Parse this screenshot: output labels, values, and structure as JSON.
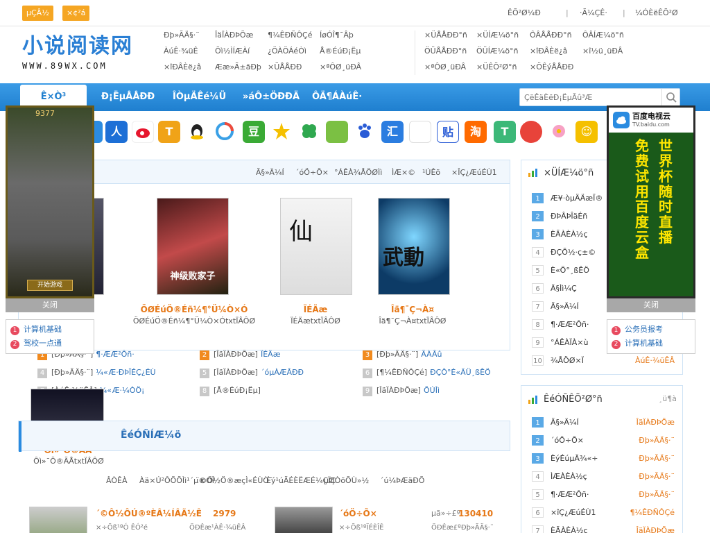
{
  "topbar": {
    "btn1": "µÇÂ½",
    "btn2": "×¢²á",
    "link1": "ÊÕ²Ø¼Ð",
    "link2": "·Ã¼ÇÊ·",
    "link3": "¼ÓÈëÊÕ²Ø",
    "sep": "|"
  },
  "logo": {
    "cn": "小说阅读网",
    "url": "WWW.89WX.COM"
  },
  "header_cats": [
    [
      "Ðþ»ÃÄ§·¨",
      "ÎäÏÀÐÞÕæ",
      "¶¼ÊÐÑÔÇé"
    ],
    [
      "ÀúÊ·¾üÊ",
      "Õì½ÌÍÆÀí",
      "ÍøÓÎ¶¯Âþ"
    ],
    [
      "¿Æ»ÃÐ¡Ëµ",
      "¿ÖÀÖÁéÒì",
      "Å®ÉúÐ¡Ëµ"
    ],
    [
      "ÆäËûÀàÐÍ",
      "Ææ»Ã±äÐþ",
      "×ÜÅÅÐÐ"
    ],
    [
      "×ÜÅÅÐÐ°ñ",
      "×ÜÍÆ¼ö°ñ",
      "ÔÂÅÅÐÐ°ñ"
    ],
    [
      "ÔÂÍÆ¼ö°ñ",
      "ÖÜÅÅÐÐ°ñ",
      "ÖÜÍÆ¼ö°ñ"
    ],
    [
      "×îÐÂÈë¿â",
      "×î½ü¸üÐÂ",
      "×ªÔØ¸üÐÂ"
    ]
  ],
  "header_right": [
    [
      "×ÜÅÅÐÐ°ñ",
      "×ÜÍÆ¼ö°ñ",
      "ÔÂÅÅÐÐ°ñ",
      "ÔÂÍÆ¼ö°ñ"
    ],
    [
      "ÖÜÅÅÐÐ°ñ",
      "ÖÜÍÆ¼ö°ñ",
      "×îÐÂÈë¿â",
      "×î½ü¸üÐÂ"
    ],
    [
      "×ªÔØ¸üÐÂ",
      "×ÜÊÕ²Ø°ñ",
      "×ÖÊýÅÅÐÐ"
    ]
  ],
  "nav": {
    "items": [
      "Ê×Ò³",
      "Ð¡ËµÅÅÐÐ",
      "ÎÒµÄÊé¼Ü",
      "»áÔ±ÖÐÐÄ",
      "ÔÄ¶ÁÀúÊ·"
    ],
    "search_placeholder": "ÇëÊäÈëÐ¡ËµÃû³Æ"
  },
  "apps": [
    "人",
    "豆",
    "贴",
    "淘"
  ],
  "hot": {
    "tabs": [
      "Ã§»Ä¼Í",
      "´óÖ÷Õ×",
      "°ÁÊÀ¾ÅÖØÌì",
      "ÌÆ×©",
      "¹ÚÊõ",
      "×ÎÇ¿ÆúÉÙ1"
    ],
    "books": [
      {
        "title": "ÖØÉúÖ®Éñ¼¶°Ü¼Ò×Ó",
        "sub": "ÖØÉúÖ®Éñ¼¶°Ü¼Ò×ÓtxtÏÂÔØ"
      },
      {
        "title": "ÏÉÄæ",
        "sub": "ÏÉÄætxtÏÂÔØ"
      },
      {
        "title": "Îä¶¯Ç¬À¤",
        "sub": "Îä¶¯Ç¬À¤txtÏÂÔØ"
      }
    ],
    "ranks": [
      [
        {
          "n": "1",
          "cat": "[Ðþ»ÃÄ§·¨]",
          "t": "¶·ÆÆ²Ôñ·"
        },
        {
          "n": "2",
          "cat": "[ÎäÏÀÐÞÕæ]",
          "t": "ÏÉÄæ"
        },
        {
          "n": "3",
          "cat": "[Ðþ»ÃÄ§·¨]",
          "t": "ÃÀÂû"
        }
      ],
      [
        {
          "n": "4",
          "cat": "[Ðþ»ÃÄ§·¨]",
          "t": "¼«Æ·ÐÞÏÉÇ¿ÉÙ"
        },
        {
          "n": "5",
          "cat": "[ÎäÏÀÐÞÕæ]",
          "t": "´óµÀÆÂÐÐ"
        },
        {
          "n": "6",
          "cat": "[¶¼ÊÐÑÔÇé]",
          "t": "ÐÇÔ°É«ÄÜ¸ßÊÖ"
        }
      ],
      [
        {
          "n": "7",
          "cat": "[ÀúÊ·¾üÊÂ]",
          "t": "¼«Æ·¼ÒÖ¡"
        },
        {
          "n": "8",
          "cat": "[Å®ÉúÐ¡Ëµ]",
          "t": ""
        },
        {
          "n": "9",
          "cat": "[ÎäÏÀÐÞÕæ]",
          "t": "ÕÚÌì"
        }
      ]
    ]
  },
  "lower": {
    "book_title": "Ôì»¯Ö®ÃÅ",
    "book_sub": "Ôì»¯Ö®ÃÅtxtÏÂÔØ",
    "section_title": "ÊéÓÑÍÆ¼ö",
    "tabs": [
      "ÂÒÊÀ",
      "Àä×Ú²ÔÕÕÌì¹´µ®ÓÎ",
      "¨©Ö½Ö®æçÌ«ÉÙÒ¯",
      "Èý¹úÃÉÈËÆÉ¼ÇÏÇ",
      "µØÒõÕÙ»½",
      "´ú¼ÞÆäÐÕ"
    ],
    "items": [
      {
        "title": "´©Ô½ÔÚ®ºÈÂ¼ÍÂÃ½Ê",
        "num": "2979",
        "sub": "×÷Õß¹ºÓ ÊÓ²é",
        "cat": "ÖÐÊæ¹ÀÊ·¾üÊÂ"
      },
      {
        "title": "´óÖ÷Õ×",
        "num": "130410",
        "sub": "×÷Õß¹ºÏÉÈÎÊ",
        "cat": "ÖÐÊæ£ºÐþ»ÃÄ§·¨",
        "pre": "µã»÷£º"
      }
    ]
  },
  "right_rank1": {
    "title": "×ÜÍÆ¼ö°ñ",
    "rows": [
      {
        "n": "1",
        "t": "Æ¥·òµÄÄæÏ®"
      },
      {
        "n": "2",
        "t": "ÐÞÂÞÎäÉñ"
      },
      {
        "n": "3",
        "t": "ÈÃÀÈÀ½ç"
      },
      {
        "n": "4",
        "t": "ÐÇÕ½·ç±©"
      },
      {
        "n": "5",
        "t": "È«Ö°¸ßÊÖ"
      },
      {
        "n": "6",
        "t": "Ä§Ìì¼Ç"
      },
      {
        "n": "7",
        "t": "Ã§»Ä¼Í"
      },
      {
        "n": "8",
        "t": "¶·ÆÆ²Ôñ·"
      },
      {
        "n": "9",
        "t": "°ÁÊÀÏÀ×ù"
      },
      {
        "n": "10",
        "t": "¾ÅÖØ×Ï",
        "tag": "ÀúÊ·¾üÊÂ"
      }
    ]
  },
  "right_rank2": {
    "title": "ÊéÓÑÊÕ²Ø°ñ",
    "more": "¸ü¶à",
    "rows": [
      {
        "n": "1",
        "t": "Ã§»Ä¼Í",
        "tag": "ÎäÏÀÐÞÕæ"
      },
      {
        "n": "2",
        "t": "´óÖ÷Õ×",
        "tag": "Ðþ»ÃÄ§·¨"
      },
      {
        "n": "3",
        "t": "ÈýÉúµÄ¾«÷",
        "tag": "Ðþ»ÃÄ§·¨"
      },
      {
        "n": "4",
        "t": "ÌÆÀÈÀ½ç",
        "tag": "Ðþ»ÃÄ§·¨"
      },
      {
        "n": "5",
        "t": "¶·ÆÆ²Ôñ·",
        "tag": "Ðþ»ÃÄ§·¨"
      },
      {
        "n": "6",
        "t": "×îÇ¿ÆúÉÙ1",
        "tag": "¶¼ÊÐÑÔÇé"
      },
      {
        "n": "7",
        "t": "ÈÃÀÈÀ½ç",
        "tag": "ÎäÏÀÐÞÕæ"
      }
    ]
  },
  "left_ad": {
    "close": "关闭",
    "links": [
      "计算机基础",
      "驾校一点通"
    ]
  },
  "right_ad": {
    "close": "关闭",
    "links": [
      "公务员报考",
      "计算机基础"
    ],
    "brand": "百度电视云",
    "brand_url": "TV.baidu.com",
    "slogan1": "免费试用百度云盒",
    "slogan2": "世界杯随时直播"
  },
  "colors": {
    "nav_blue": "#1f7fcf",
    "accent_orange": "#e67817",
    "link_blue": "#2a6fb7"
  }
}
